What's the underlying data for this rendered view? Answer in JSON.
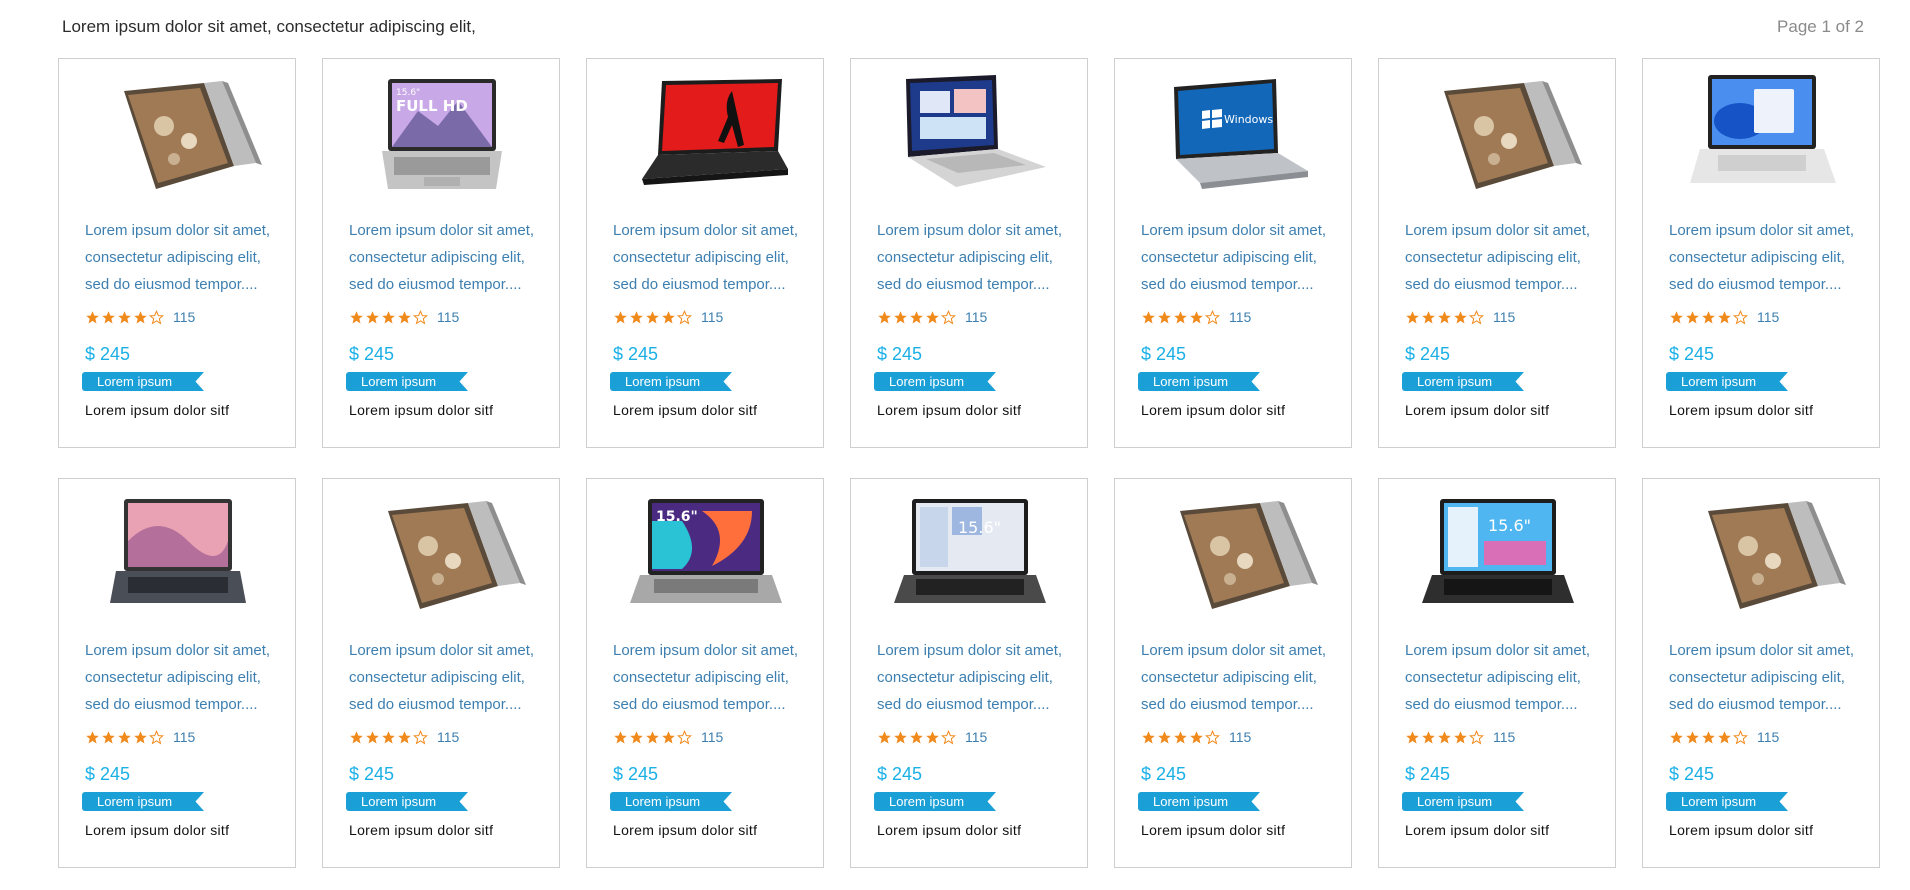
{
  "header": {
    "title": "Lorem ipsum dolor sit amet, consectetur adipiscing elit,",
    "page_indicator": "Page 1 of 2"
  },
  "colors": {
    "link_text": "#3d7fb0",
    "price": "#1ab0e6",
    "ribbon": "#1a9fd6",
    "star": "#f08a1c"
  },
  "products": [
    {
      "image": "laptop-tent-icon",
      "description": "Lorem ipsum dolor sit amet, consectetur adipiscing elit, sed do eiusmod tempor....",
      "rating": 4,
      "rating_count": "115",
      "price": "$ 245",
      "badge": "Lorem ipsum",
      "footer": "Lorem ipsum dolor sitf"
    },
    {
      "image": "laptop-silver-fullhd-icon",
      "description": "Lorem ipsum dolor sit amet, consectetur adipiscing elit, sed do eiusmod tempor....",
      "rating": 4,
      "rating_count": "115",
      "price": "$ 245",
      "badge": "Lorem ipsum",
      "footer": "Lorem ipsum dolor sitf"
    },
    {
      "image": "laptop-black-red-screen-icon",
      "description": "Lorem ipsum dolor sit amet, consectetur adipiscing elit, sed do eiusmod tempor....",
      "rating": 4,
      "rating_count": "115",
      "price": "$ 245",
      "badge": "Lorem ipsum",
      "footer": "Lorem ipsum dolor sitf"
    },
    {
      "image": "laptop-silver-angled-icon",
      "description": "Lorem ipsum dolor sit amet, consectetur adipiscing elit, sed do eiusmod tempor....",
      "rating": 4,
      "rating_count": "115",
      "price": "$ 245",
      "badge": "Lorem ipsum",
      "footer": "Lorem ipsum dolor sitf"
    },
    {
      "image": "laptop-windows10-icon",
      "description": "Lorem ipsum dolor sit amet, consectetur adipiscing elit, sed do eiusmod tempor....",
      "rating": 4,
      "rating_count": "115",
      "price": "$ 245",
      "badge": "Lorem ipsum",
      "footer": "Lorem ipsum dolor sitf"
    },
    {
      "image": "laptop-tent-icon",
      "description": "Lorem ipsum dolor sit amet, consectetur adipiscing elit, sed do eiusmod tempor....",
      "rating": 4,
      "rating_count": "115",
      "price": "$ 245",
      "badge": "Lorem ipsum",
      "footer": "Lorem ipsum dolor sitf"
    },
    {
      "image": "laptop-silver-windows11-icon",
      "description": "Lorem ipsum dolor sit amet, consectetur adipiscing elit, sed do eiusmod tempor....",
      "rating": 4,
      "rating_count": "115",
      "price": "$ 245",
      "badge": "Lorem ipsum",
      "footer": "Lorem ipsum dolor sitf"
    },
    {
      "image": "laptop-pink-screen-icon",
      "description": "Lorem ipsum dolor sit amet, consectetur adipiscing elit, sed do eiusmod tempor....",
      "rating": 4,
      "rating_count": "115",
      "price": "$ 245",
      "badge": "Lorem ipsum",
      "footer": "Lorem ipsum dolor sitf"
    },
    {
      "image": "laptop-tent-icon",
      "description": "Lorem ipsum dolor sit amet, consectetur adipiscing elit, sed do eiusmod tempor....",
      "rating": 4,
      "rating_count": "115",
      "price": "$ 245",
      "badge": "Lorem ipsum",
      "footer": "Lorem ipsum dolor sitf"
    },
    {
      "image": "laptop-15-6-colorful-icon",
      "description": "Lorem ipsum dolor sit amet, consectetur adipiscing elit, sed do eiusmod tempor....",
      "rating": 4,
      "rating_count": "115",
      "price": "$ 245",
      "badge": "Lorem ipsum",
      "footer": "Lorem ipsum dolor sitf"
    },
    {
      "image": "laptop-15-6-dark-icon",
      "description": "Lorem ipsum dolor sit amet, consectetur adipiscing elit, sed do eiusmod tempor....",
      "rating": 4,
      "rating_count": "115",
      "price": "$ 245",
      "badge": "Lorem ipsum",
      "footer": "Lorem ipsum dolor sitf"
    },
    {
      "image": "laptop-tent-icon",
      "description": "Lorem ipsum dolor sit amet, consectetur adipiscing elit, sed do eiusmod tempor....",
      "rating": 4,
      "rating_count": "115",
      "price": "$ 245",
      "badge": "Lorem ipsum",
      "footer": "Lorem ipsum dolor sitf"
    },
    {
      "image": "laptop-15-6-blue-icon",
      "description": "Lorem ipsum dolor sit amet, consectetur adipiscing elit, sed do eiusmod tempor....",
      "rating": 4,
      "rating_count": "115",
      "price": "$ 245",
      "badge": "Lorem ipsum",
      "footer": "Lorem ipsum dolor sitf"
    },
    {
      "image": "laptop-tent-icon",
      "description": "Lorem ipsum dolor sit amet, consectetur adipiscing elit, sed do eiusmod tempor....",
      "rating": 4,
      "rating_count": "115",
      "price": "$ 245",
      "badge": "Lorem ipsum",
      "footer": "Lorem ipsum dolor sitf"
    }
  ],
  "image_labels": {
    "fullhd": "15.6\" FULL HD",
    "win10": "Windows 10",
    "size": "15.6\""
  }
}
